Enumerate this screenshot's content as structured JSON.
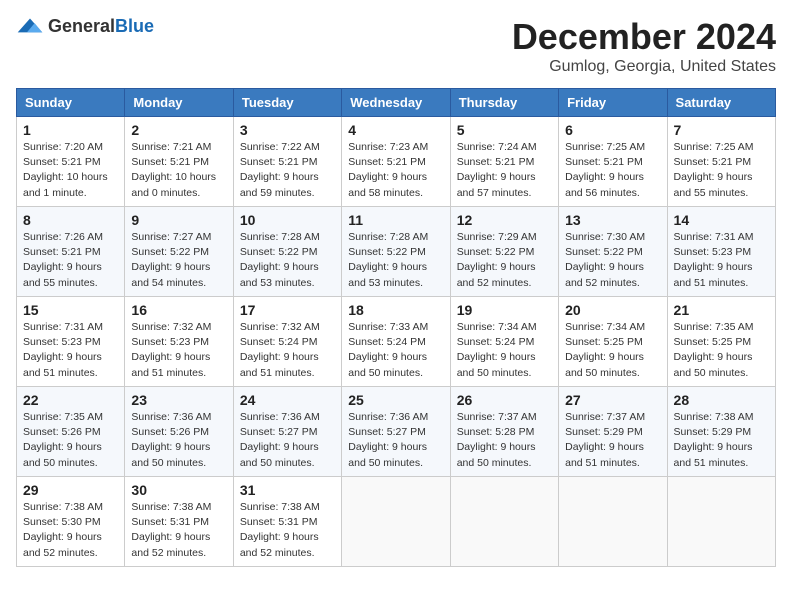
{
  "header": {
    "logo_general": "General",
    "logo_blue": "Blue",
    "month_title": "December 2024",
    "location": "Gumlog, Georgia, United States"
  },
  "weekdays": [
    "Sunday",
    "Monday",
    "Tuesday",
    "Wednesday",
    "Thursday",
    "Friday",
    "Saturday"
  ],
  "weeks": [
    [
      {
        "day": "1",
        "sunrise": "7:20 AM",
        "sunset": "5:21 PM",
        "daylight": "10 hours and 1 minute."
      },
      {
        "day": "2",
        "sunrise": "7:21 AM",
        "sunset": "5:21 PM",
        "daylight": "10 hours and 0 minutes."
      },
      {
        "day": "3",
        "sunrise": "7:22 AM",
        "sunset": "5:21 PM",
        "daylight": "9 hours and 59 minutes."
      },
      {
        "day": "4",
        "sunrise": "7:23 AM",
        "sunset": "5:21 PM",
        "daylight": "9 hours and 58 minutes."
      },
      {
        "day": "5",
        "sunrise": "7:24 AM",
        "sunset": "5:21 PM",
        "daylight": "9 hours and 57 minutes."
      },
      {
        "day": "6",
        "sunrise": "7:25 AM",
        "sunset": "5:21 PM",
        "daylight": "9 hours and 56 minutes."
      },
      {
        "day": "7",
        "sunrise": "7:25 AM",
        "sunset": "5:21 PM",
        "daylight": "9 hours and 55 minutes."
      }
    ],
    [
      {
        "day": "8",
        "sunrise": "7:26 AM",
        "sunset": "5:21 PM",
        "daylight": "9 hours and 55 minutes."
      },
      {
        "day": "9",
        "sunrise": "7:27 AM",
        "sunset": "5:22 PM",
        "daylight": "9 hours and 54 minutes."
      },
      {
        "day": "10",
        "sunrise": "7:28 AM",
        "sunset": "5:22 PM",
        "daylight": "9 hours and 53 minutes."
      },
      {
        "day": "11",
        "sunrise": "7:28 AM",
        "sunset": "5:22 PM",
        "daylight": "9 hours and 53 minutes."
      },
      {
        "day": "12",
        "sunrise": "7:29 AM",
        "sunset": "5:22 PM",
        "daylight": "9 hours and 52 minutes."
      },
      {
        "day": "13",
        "sunrise": "7:30 AM",
        "sunset": "5:22 PM",
        "daylight": "9 hours and 52 minutes."
      },
      {
        "day": "14",
        "sunrise": "7:31 AM",
        "sunset": "5:23 PM",
        "daylight": "9 hours and 51 minutes."
      }
    ],
    [
      {
        "day": "15",
        "sunrise": "7:31 AM",
        "sunset": "5:23 PM",
        "daylight": "9 hours and 51 minutes."
      },
      {
        "day": "16",
        "sunrise": "7:32 AM",
        "sunset": "5:23 PM",
        "daylight": "9 hours and 51 minutes."
      },
      {
        "day": "17",
        "sunrise": "7:32 AM",
        "sunset": "5:24 PM",
        "daylight": "9 hours and 51 minutes."
      },
      {
        "day": "18",
        "sunrise": "7:33 AM",
        "sunset": "5:24 PM",
        "daylight": "9 hours and 50 minutes."
      },
      {
        "day": "19",
        "sunrise": "7:34 AM",
        "sunset": "5:24 PM",
        "daylight": "9 hours and 50 minutes."
      },
      {
        "day": "20",
        "sunrise": "7:34 AM",
        "sunset": "5:25 PM",
        "daylight": "9 hours and 50 minutes."
      },
      {
        "day": "21",
        "sunrise": "7:35 AM",
        "sunset": "5:25 PM",
        "daylight": "9 hours and 50 minutes."
      }
    ],
    [
      {
        "day": "22",
        "sunrise": "7:35 AM",
        "sunset": "5:26 PM",
        "daylight": "9 hours and 50 minutes."
      },
      {
        "day": "23",
        "sunrise": "7:36 AM",
        "sunset": "5:26 PM",
        "daylight": "9 hours and 50 minutes."
      },
      {
        "day": "24",
        "sunrise": "7:36 AM",
        "sunset": "5:27 PM",
        "daylight": "9 hours and 50 minutes."
      },
      {
        "day": "25",
        "sunrise": "7:36 AM",
        "sunset": "5:27 PM",
        "daylight": "9 hours and 50 minutes."
      },
      {
        "day": "26",
        "sunrise": "7:37 AM",
        "sunset": "5:28 PM",
        "daylight": "9 hours and 50 minutes."
      },
      {
        "day": "27",
        "sunrise": "7:37 AM",
        "sunset": "5:29 PM",
        "daylight": "9 hours and 51 minutes."
      },
      {
        "day": "28",
        "sunrise": "7:38 AM",
        "sunset": "5:29 PM",
        "daylight": "9 hours and 51 minutes."
      }
    ],
    [
      {
        "day": "29",
        "sunrise": "7:38 AM",
        "sunset": "5:30 PM",
        "daylight": "9 hours and 52 minutes."
      },
      {
        "day": "30",
        "sunrise": "7:38 AM",
        "sunset": "5:31 PM",
        "daylight": "9 hours and 52 minutes."
      },
      {
        "day": "31",
        "sunrise": "7:38 AM",
        "sunset": "5:31 PM",
        "daylight": "9 hours and 52 minutes."
      },
      null,
      null,
      null,
      null
    ]
  ]
}
